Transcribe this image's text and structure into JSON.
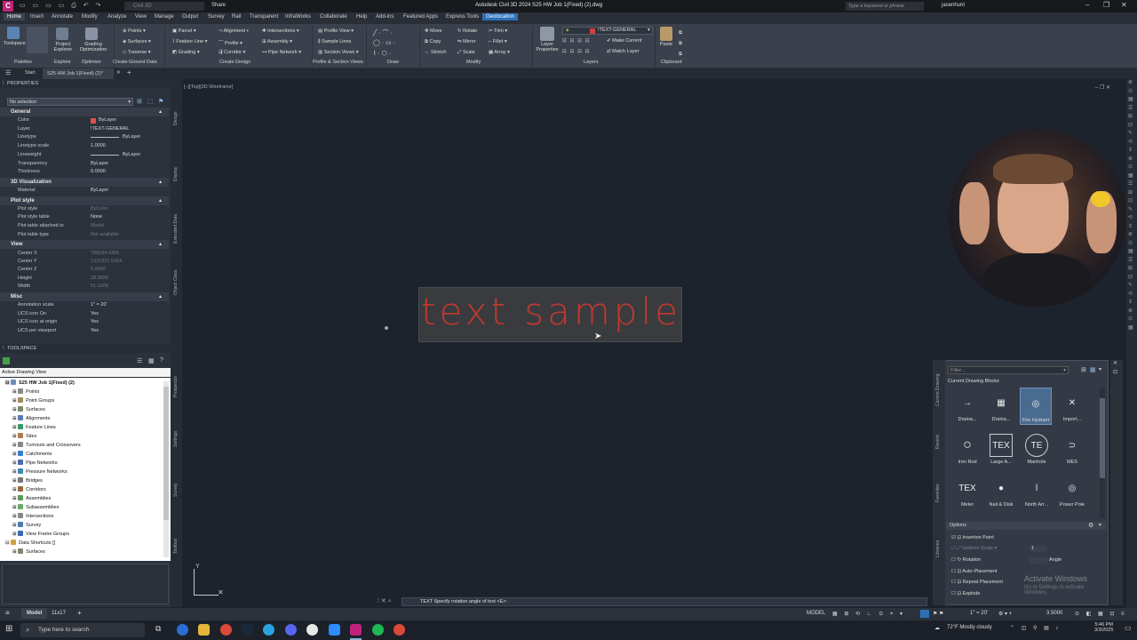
{
  "titlebar": {
    "workspace": "Civil 3D",
    "share": "Share",
    "title": "Autodesk Civil 3D 2024   S25 HW Job 1(Fixed) (2).dwg",
    "search_placeholder": "Type a keyword or phrase",
    "user": "jasenhunt"
  },
  "ribbon_tabs": [
    "Home",
    "Insert",
    "Annotate",
    "Modify",
    "Analyze",
    "View",
    "Manage",
    "Output",
    "Survey",
    "Rail",
    "Transparent",
    "InfraWorks",
    "Collaborate",
    "Help",
    "Add-ins",
    "Featured Apps",
    "Express Tools",
    "Geolocation"
  ],
  "ribbon": {
    "toolspace": "Toolspace",
    "project_explorer": "Project Explorer",
    "grading_optimization": "Grading Optimization",
    "points": "Points",
    "surfaces": "Surfaces",
    "traverse": "Traverse",
    "parcel": "Parcel",
    "feature_line": "Feature Line",
    "grading": "Grading",
    "alignment": "Alignment",
    "profile": "Profile",
    "corridor": "Corridor",
    "intersections": "Intersections",
    "assembly": "Assembly",
    "pipe_network": "Pipe Network",
    "profile_view": "Profile View",
    "sample_lines": "Sample Lines",
    "section_views": "Section Views",
    "move": "Move",
    "rotate": "Rotate",
    "trim": "Trim",
    "copy": "Copy",
    "mirror": "Mirror",
    "fillet": "Fillet",
    "stretch": "Stretch",
    "scale": "Scale",
    "array": "Array",
    "layer_properties": "Layer Properties",
    "layer_name": "!TEXT-GENERAL",
    "make_current": "Make Current",
    "match_layer": "Match Layer",
    "paste": "Paste",
    "panels": [
      "Palettes",
      "Explore",
      "Optimize",
      "Create Ground Data",
      "Create Design",
      "Profile & Section Views",
      "Draw",
      "Modify",
      "Layers",
      "Clipboard"
    ]
  },
  "file_tabs": {
    "start": "Start",
    "current": "S25 HW Job 1(Fixed) (2)*"
  },
  "viewport_label": "[−][Top][2D Wireframe]",
  "properties": {
    "title": "PROPERTIES",
    "selection": "No selection",
    "general_header": "General",
    "general": [
      {
        "k": "Color",
        "v": "ByLayer"
      },
      {
        "k": "Layer",
        "v": "!TEXT-GENERAL"
      },
      {
        "k": "Linetype",
        "v": "ByLayer"
      },
      {
        "k": "Linetype scale",
        "v": "1.0000"
      },
      {
        "k": "Lineweight",
        "v": "ByLayer"
      },
      {
        "k": "Transparency",
        "v": "ByLayer"
      },
      {
        "k": "Thickness",
        "v": "0.0000"
      }
    ],
    "viz_header": "3D Visualization",
    "viz": [
      {
        "k": "Material",
        "v": "ByLayer"
      }
    ],
    "plot_header": "Plot style",
    "plot": [
      {
        "k": "Plot style",
        "v": "ByColor"
      },
      {
        "k": "Plot style table",
        "v": "None"
      },
      {
        "k": "Plot table attached to",
        "v": "Model"
      },
      {
        "k": "Plot table type",
        "v": "Not available"
      }
    ],
    "view_header": "View",
    "view": [
      {
        "k": "Center X",
        "v": "786034.0356"
      },
      {
        "k": "Center Y",
        "v": "1322321.5254"
      },
      {
        "k": "Center Z",
        "v": "0.0000"
      },
      {
        "k": "Height",
        "v": "28.3898"
      },
      {
        "k": "Width",
        "v": "51.1608"
      }
    ],
    "misc_header": "Misc",
    "misc": [
      {
        "k": "Annotation scale",
        "v": "1\" = 20'"
      },
      {
        "k": "UCS icon On",
        "v": "Yes"
      },
      {
        "k": "UCS icon at origin",
        "v": "Yes"
      },
      {
        "k": "UCS per viewport",
        "v": "Yes"
      }
    ],
    "side_tabs": [
      "Design",
      "Display",
      "Extended Data",
      "Object Class"
    ]
  },
  "toolspace": {
    "title": "TOOLSPACE",
    "view": "Active Drawing View",
    "root": "S25 HW Job 1(Fixed) (2)",
    "items": [
      "Points",
      "Point Groups",
      "Surfaces",
      "Alignments",
      "Feature Lines",
      "Sites",
      "Turnouts and Crossovers",
      "Catchments",
      "Pipe Networks",
      "Pressure Networks",
      "Bridges",
      "Corridors",
      "Assemblies",
      "Subassemblies",
      "Intersections",
      "Survey",
      "View Frame Groups"
    ],
    "shortcuts": "Data Shortcuts []",
    "shortcut_items": [
      "Surfaces"
    ],
    "side_tabs": [
      "Prospector",
      "Settings",
      "Survey",
      "Toolbox"
    ]
  },
  "canvas": {
    "text_sample": "text sample"
  },
  "command_line": "TEXT Specify rotation angle of text <E>:",
  "palette": {
    "filter": "Filter...",
    "section": "Current Drawing Blocks",
    "blocks": [
      {
        "label": "Draina...",
        "glyph": "→"
      },
      {
        "label": "Draina...",
        "glyph": "▦"
      },
      {
        "label": "Fire Hydrant",
        "glyph": "◎"
      },
      {
        "label": "Import...",
        "glyph": "✕"
      },
      {
        "label": "Iron Rod",
        "glyph": "○"
      },
      {
        "label": "Large A...",
        "glyph": "TEX"
      },
      {
        "label": "Manhole",
        "glyph": "TE"
      },
      {
        "label": "MES",
        "glyph": "⊃"
      },
      {
        "label": "Meter",
        "glyph": "TEX"
      },
      {
        "label": "Nail & Disk",
        "glyph": "●"
      },
      {
        "label": "North Arr...",
        "glyph": "ǀ"
      },
      {
        "label": "Power Pole",
        "glyph": "◎"
      }
    ],
    "options_title": "Options",
    "options": [
      "Insertion Point",
      "Uniform Scale",
      "Rotation",
      "Auto-Placement",
      "Repeat Placement",
      "Explode"
    ],
    "scale_value": "1",
    "angle_label": "Angle",
    "side_tabs": [
      "Current Drawing",
      "Recent",
      "Favorites",
      "Libraries"
    ],
    "activate_line1": "Activate Windows",
    "activate_line2": "Go to Settings to activate Windows."
  },
  "status": {
    "model_tab": "Model",
    "layout_tab": "11x17",
    "model": "MODEL",
    "scale": "1\" = 20'",
    "value": "3.5000"
  },
  "taskbar": {
    "search": "Type here to search",
    "weather": "72°F  Mostly cloudy",
    "time": "5:46 PM",
    "date": "3/3/2025"
  }
}
